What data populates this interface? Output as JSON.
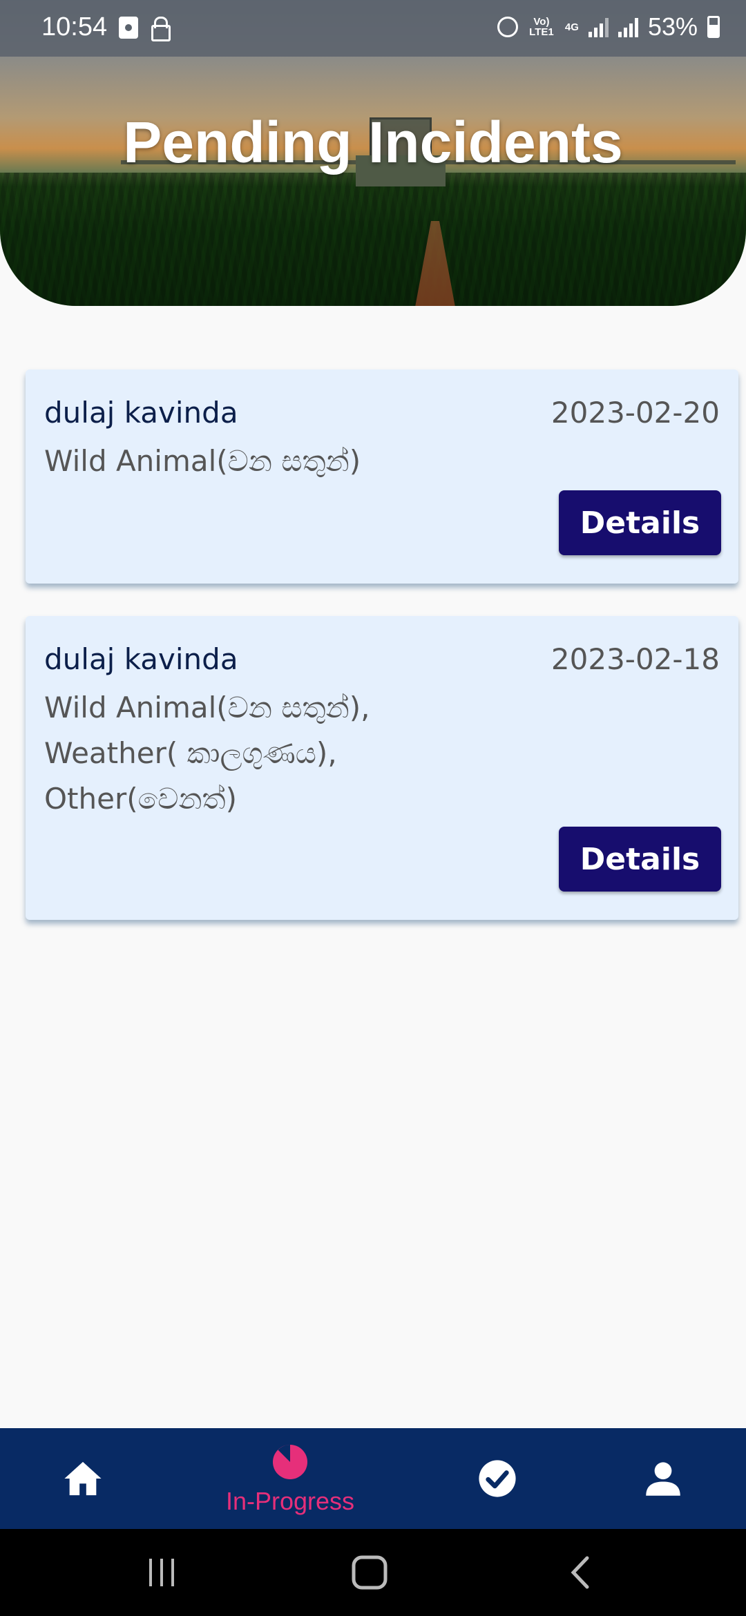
{
  "status_bar": {
    "time": "10:54",
    "volte_label": "Vo) LTE1",
    "network_label": "4G",
    "battery": "53%"
  },
  "header": {
    "title": "Pending Incidents"
  },
  "incidents": [
    {
      "name": "dulaj kavinda",
      "date": "2023-02-20",
      "types": [
        "Wild Animal(වන සතුන්)"
      ],
      "button_label": "Details"
    },
    {
      "name": "dulaj kavinda",
      "date": "2023-02-18",
      "types": [
        "Wild Animal(වන සතුන්),",
        "Weather( කාලගුණය),",
        "Other(වෙනත්)"
      ],
      "button_label": "Details"
    }
  ],
  "bottom_nav": {
    "items": [
      {
        "icon": "home-icon",
        "label": ""
      },
      {
        "icon": "in-progress-icon",
        "label": "In-Progress",
        "active": true
      },
      {
        "icon": "check-circle-icon",
        "label": ""
      },
      {
        "icon": "person-icon",
        "label": ""
      }
    ],
    "active_color": "#e62f7a",
    "background": "#082a64"
  },
  "colors": {
    "button": "#170d6e",
    "card": "#e5f0fd"
  }
}
